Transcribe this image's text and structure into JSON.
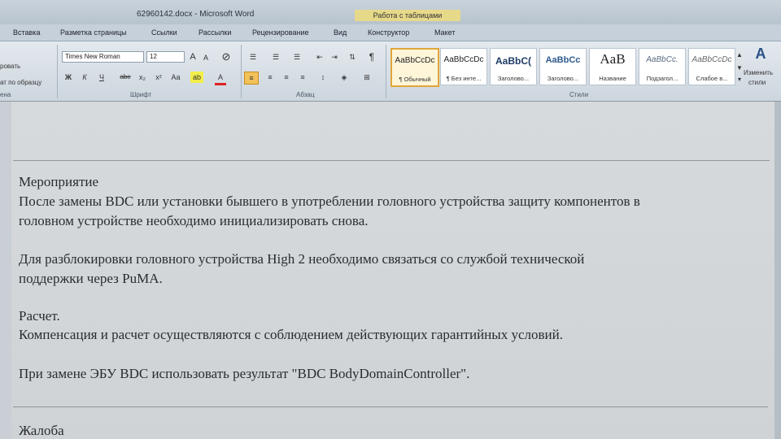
{
  "window": {
    "title": "62960142.docx - Microsoft Word",
    "context_tab_group": "Работа с таблицами"
  },
  "tabs": [
    "Вставка",
    "Разметка страницы",
    "Ссылки",
    "Рассылки",
    "Рецензирование",
    "Вид",
    "Конструктор",
    "Макет"
  ],
  "clipboard": {
    "cut_label": "ровать",
    "format_painter_label": "ат по образцу",
    "group_label": "ена"
  },
  "font": {
    "name": "Times New Roman",
    "size": "12",
    "group_label": "Шрифт",
    "bold": "Ж",
    "italic": "К",
    "underline": "Ч",
    "strike": "abe",
    "subscript": "x₂",
    "superscript": "x²",
    "case": "Aa",
    "grow": "A",
    "shrink": "A",
    "color": "A"
  },
  "paragraph": {
    "group_label": "Абзац",
    "pilcrow": "¶"
  },
  "styles": {
    "group_label": "Стили",
    "items": [
      {
        "sample": "AaBbCcDc",
        "name": "¶ Обычный"
      },
      {
        "sample": "AaBbCcDc",
        "name": "¶ Без инте..."
      },
      {
        "sample": "AaBbC(",
        "name": "Заголово..."
      },
      {
        "sample": "AaBbCc",
        "name": "Заголово..."
      },
      {
        "sample": "AaB",
        "name": "Название"
      },
      {
        "sample": "AaBbCc.",
        "name": "Подзагол..."
      },
      {
        "sample": "AaBbCcDc",
        "name": "Слабое в..."
      }
    ],
    "change_label_1": "Изменить",
    "change_label_2": "стили"
  },
  "document": {
    "lines": [
      "Мероприятие",
      "После замены BDC или установки бывшего в употреблении головного устройства защиту компонентов в",
      "головном устройстве необходимо  инициализировать снова.",
      "Для разблокировки головного устройства High 2 необходимо связаться со службой технической",
      "поддержки через PuMA.",
      "Расчет.",
      "Компенсация и расчет осуществляются с соблюдением действующих гарантийных условий.",
      "При замене ЭБУ BDC использовать результат \"BDC BodyDomainController\".",
      "Жалоба"
    ]
  }
}
